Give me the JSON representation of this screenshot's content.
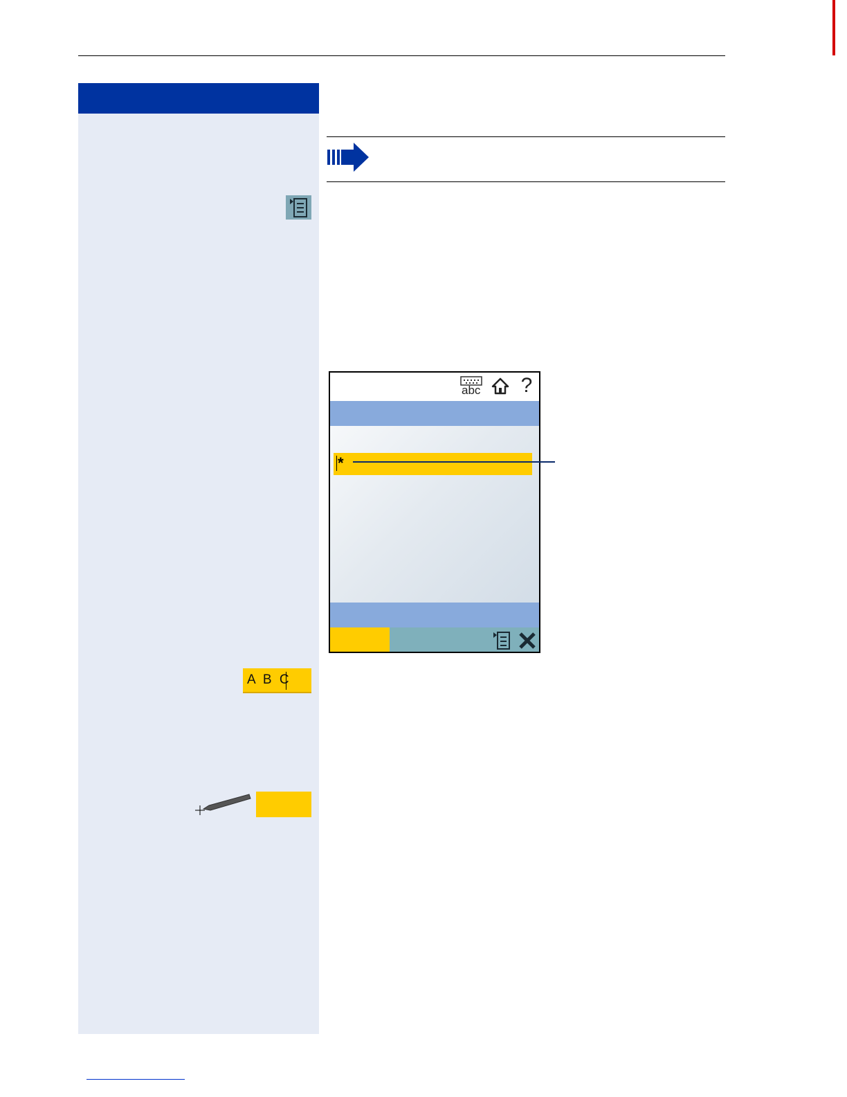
{
  "colors": {
    "brand_blue": "#0033a0",
    "sidebar_bg": "#e6ebf5",
    "accent_yellow": "#ffcc00",
    "screen_bar_blue": "#88aadc",
    "screen_softkey_teal": "#7fb0bb",
    "side_tab_red": "#d40000"
  },
  "icons": {
    "note": "arrow-right-icon",
    "menu": "menu-list-icon",
    "keyboard": "keyboard-abc-icon",
    "home": "home-icon",
    "help": "question-mark-icon",
    "close": "close-x-icon",
    "stylus": "stylus-pen-icon"
  },
  "phone_screen": {
    "keyboard_label": "abc",
    "help_label": "?",
    "input_field_value": "*"
  },
  "sidebar": {
    "abc_field_value": "A B C"
  }
}
